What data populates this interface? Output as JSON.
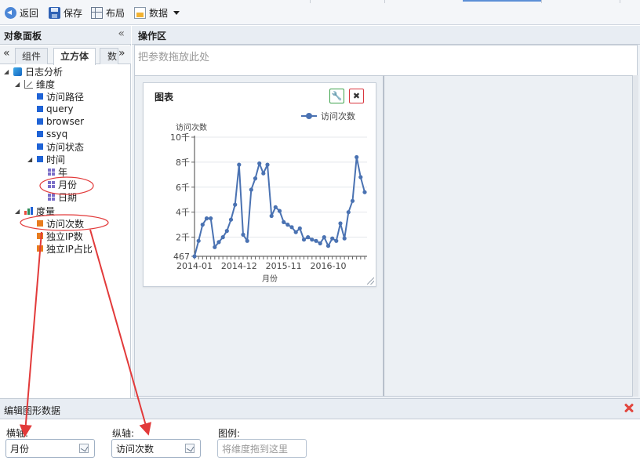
{
  "toolbar": {
    "back_label": "返回",
    "save_label": "保存",
    "layout_label": "布局",
    "data_label": "数据"
  },
  "left_panel": {
    "title": "对象面板",
    "collapse_icon": "double-chevron-left-icon",
    "tabs": [
      {
        "label": "组件",
        "active": false
      },
      {
        "label": "立方体",
        "active": true
      },
      {
        "label": "数",
        "active": false
      }
    ],
    "tree": {
      "root": "日志分析",
      "dimensions_label": "维度",
      "dimensions": [
        "访问路径",
        "query",
        "browser",
        "ssyq",
        "访问状态"
      ],
      "time_label": "时间",
      "time_items": [
        "年",
        "月份",
        "日期"
      ],
      "measures_label": "度量",
      "measures": [
        "访问次数",
        "独立IP数",
        "独立IP占比"
      ]
    }
  },
  "work_area": {
    "title": "操作区",
    "param_placeholder": "把参数拖放此处",
    "chart_card": {
      "title": "图表",
      "wrench_icon": "wrench-icon",
      "close_icon": "close-icon"
    }
  },
  "chart_data": {
    "type": "line",
    "title": "",
    "ylabel": "访问次数",
    "xlabel": "月份",
    "legend": "top-right",
    "series": [
      {
        "name": "访问次数",
        "color": "#4a72b2",
        "values": [
          467,
          1700,
          3000,
          3500,
          3500,
          1200,
          1600,
          2000,
          2500,
          3400,
          4600,
          7800,
          2200,
          1700,
          5800,
          6700,
          7900,
          7100,
          7800,
          3700,
          4400,
          4100,
          3200,
          3000,
          2800,
          2400,
          2700,
          1800,
          2000,
          1800,
          1700,
          1500,
          2000,
          1300,
          1900,
          1700,
          3100,
          1900,
          4000,
          4900,
          8400,
          6800,
          5600
        ]
      }
    ],
    "x_ticks": [
      "2014-01",
      "2014-12",
      "2015-11",
      "2016-10"
    ],
    "y_ticks": [
      "467",
      "2千",
      "4千",
      "6千",
      "8千",
      "10千"
    ],
    "y_tick_values": [
      467,
      2000,
      4000,
      6000,
      8000,
      10000
    ],
    "ylim": [
      467,
      10000
    ],
    "grid": true
  },
  "bottom_panel": {
    "title": "编辑图形数据",
    "x_axis_label": "横轴:",
    "x_axis_value": "月份",
    "y_axis_label": "纵轴:",
    "y_axis_value": "访问次数",
    "legend_label": "图例:",
    "legend_placeholder": "将维度拖到这里"
  },
  "colors": {
    "annotation_red": "#e23a3a",
    "series_blue": "#4a72b2"
  }
}
